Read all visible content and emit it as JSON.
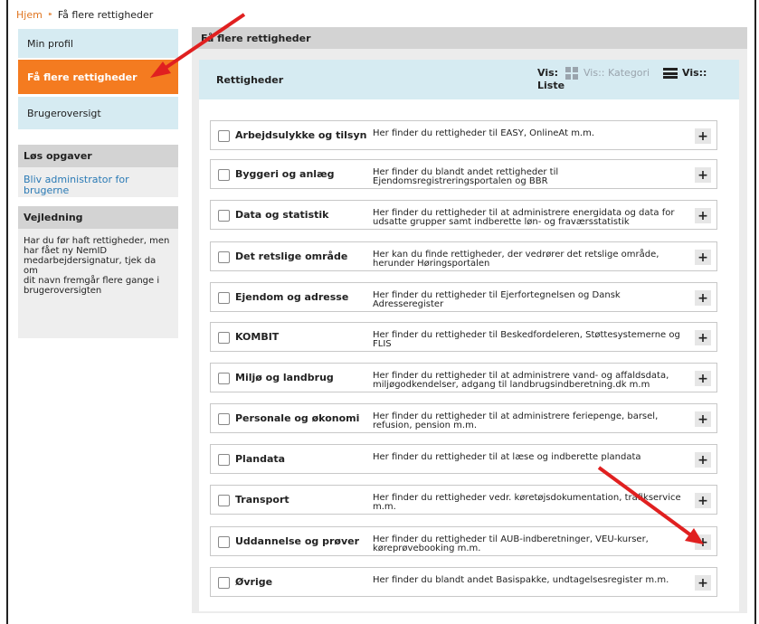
{
  "breadcrumb": {
    "home": "Hjem",
    "separator": "⁍",
    "current": "Få flere rettigheder"
  },
  "sidebar": {
    "items": [
      {
        "label": "Min profil"
      },
      {
        "label": "Få flere rettigheder"
      },
      {
        "label": "Brugeroversigt"
      }
    ],
    "tasks": {
      "heading": "Løs opgaver",
      "link": "Bliv administrator for brugerne"
    },
    "guide": {
      "heading": "Vejledning",
      "lines": [
        "Har du før haft rettigheder, men",
        "har fået ny NemID",
        "medarbejdersignatur, tjek da om",
        "dit navn fremgår flere gange i",
        "brugeroversigten"
      ]
    }
  },
  "main": {
    "title": "Få flere rettigheder",
    "header": {
      "title": "Rettigheder",
      "vis": "Vis:",
      "vis_kategori": "Vis:: Kategori",
      "vis_liste_a": "Vis::",
      "vis_liste_b": "Liste"
    },
    "categories": [
      {
        "name": "Arbejdsulykke og tilsyn",
        "desc": "Her finder du rettigheder til EASY, OnlineAt m.m."
      },
      {
        "name": "Byggeri og anlæg",
        "desc": "Her finder du blandt andet rettigheder til Ejendomsregistreringsportalen og BBR"
      },
      {
        "name": "Data og statistik",
        "desc": "Her finder du rettigheder til at administrere energidata og data for udsatte grupper samt indberette løn- og fraværsstatistik"
      },
      {
        "name": "Det retslige område",
        "desc": "Her kan du finde rettigheder, der vedrører det retslige område, herunder Høringsportalen"
      },
      {
        "name": "Ejendom og adresse",
        "desc": "Her finder du rettigheder til Ejerfortegnelsen og Dansk Adresseregister"
      },
      {
        "name": "KOMBIT",
        "desc": "Her finder du rettigheder til Beskedfordeleren, Støttesystemerne og FLIS"
      },
      {
        "name": "Miljø og landbrug",
        "desc": "Her finder du rettigheder til at administrere vand- og affaldsdata, miljøgodkendelser, adgang til landbrugsindberetning.dk m.m"
      },
      {
        "name": "Personale og økonomi",
        "desc": "Her finder du rettigheder til at administrere feriepenge, barsel, refusion, pension m.m."
      },
      {
        "name": "Plandata",
        "desc": "Her finder du rettigheder til at læse og indberette plandata"
      },
      {
        "name": "Transport",
        "desc": "Her finder du rettigheder vedr. køretøjsdokumentation, trafikservice m.m."
      },
      {
        "name": "Uddannelse og prøver",
        "desc": "Her finder du rettigheder til AUB-indberetninger, VEU-kurser, køreprøvebooking m.m."
      },
      {
        "name": "Øvrige",
        "desc": "Her finder du blandt andet Basispakke, undtagelsesregister m.m."
      }
    ],
    "plus_symbol": "+"
  },
  "colors": {
    "accent": "#f47b20",
    "nav_bg": "#d6ebf2",
    "arrow": "#e02020",
    "link": "#2a7ab5"
  }
}
